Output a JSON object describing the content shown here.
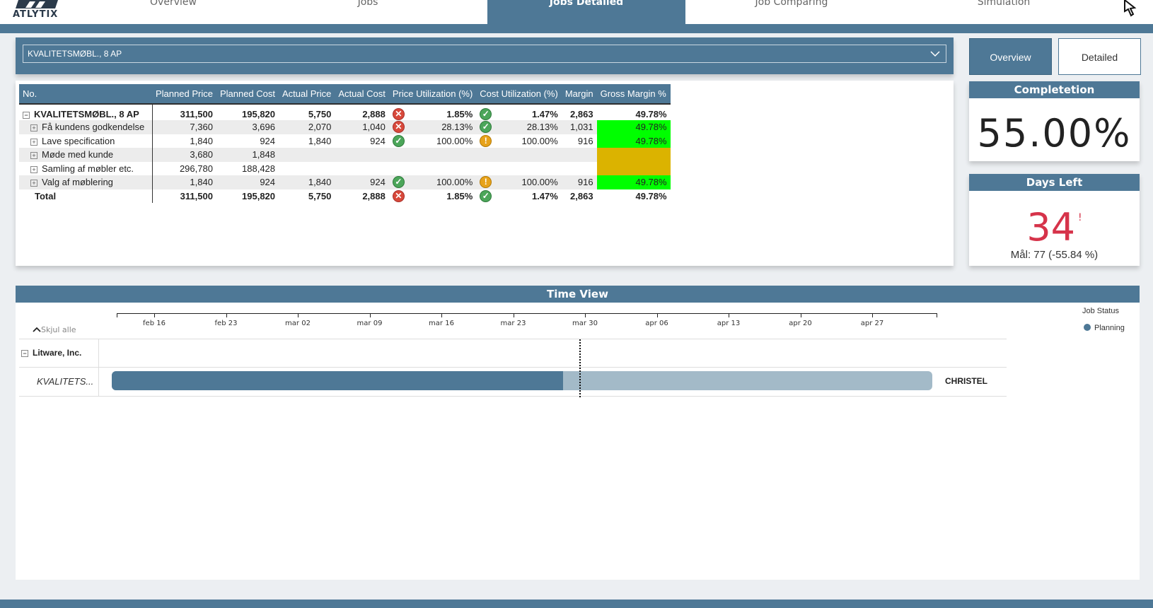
{
  "brand": {
    "name": "ATLYTIX"
  },
  "nav": {
    "tabs": [
      {
        "label": "Overview"
      },
      {
        "label": "Jobs"
      },
      {
        "label": "Jobs Detailed",
        "active": true
      },
      {
        "label": "Job Comparing"
      },
      {
        "label": "Simulation"
      }
    ]
  },
  "job_select": {
    "value": "KVALITETSMØBL., 8 AP"
  },
  "view_buttons": {
    "overview": "Overview",
    "detailed": "Detailed"
  },
  "matrix": {
    "headers": [
      "No.",
      "Planned Price",
      "Planned Cost",
      "Actual Price",
      "Actual Cost",
      "Price Utilization (%)",
      "Cost Utilization (%)",
      "Margin",
      "Gross Margin %"
    ],
    "rows": [
      {
        "name": "KVALITETSMØBL., 8 AP",
        "planned_price": "311,500",
        "planned_cost": "195,820",
        "actual_price": "5,750",
        "actual_cost": "2,888",
        "price_icon": "x",
        "price_util": "1.85%",
        "cost_icon": "ok",
        "cost_util": "1.47%",
        "margin": "2,863",
        "gross_margin": "49.78%"
      },
      {
        "name": "Få kundens godkendelse",
        "planned_price": "7,360",
        "planned_cost": "3,696",
        "actual_price": "2,070",
        "actual_cost": "1,040",
        "price_icon": "x",
        "price_util": "28.13%",
        "cost_icon": "ok",
        "cost_util": "28.13%",
        "margin": "1,031",
        "gross_margin": "49.78%"
      },
      {
        "name": "Lave specification",
        "planned_price": "1,840",
        "planned_cost": "924",
        "actual_price": "1,840",
        "actual_cost": "924",
        "price_icon": "ok",
        "price_util": "100.00%",
        "cost_icon": "warn",
        "cost_util": "100.00%",
        "margin": "916",
        "gross_margin": "49.78%"
      },
      {
        "name": "Møde med kunde",
        "planned_price": "3,680",
        "planned_cost": "1,848"
      },
      {
        "name": "Samling af møbler etc.",
        "planned_price": "296,780",
        "planned_cost": "188,428"
      },
      {
        "name": "Valg af møblering",
        "planned_price": "1,840",
        "planned_cost": "924",
        "actual_price": "1,840",
        "actual_cost": "924",
        "price_icon": "ok",
        "price_util": "100.00%",
        "cost_icon": "warn",
        "cost_util": "100.00%",
        "margin": "916",
        "gross_margin": "49.78%"
      }
    ],
    "total": {
      "name": "Total",
      "planned_price": "311,500",
      "planned_cost": "195,820",
      "actual_price": "5,750",
      "actual_cost": "2,888",
      "price_icon": "x",
      "price_util": "1.85%",
      "cost_icon": "ok",
      "cost_util": "1.47%",
      "margin": "2,863",
      "gross_margin": "49.78%"
    }
  },
  "completion": {
    "title": "Completetion",
    "value": "55.00%",
    "progress": 0.55
  },
  "days_left": {
    "title": "Days Left",
    "value": "34",
    "flag": "!",
    "target": "Mål: 77 (-55.84 %)"
  },
  "time_view": {
    "title": "Time View",
    "axis_ticks": [
      "feb 16",
      "feb 23",
      "mar 02",
      "mar 09",
      "mar 16",
      "mar 23",
      "mar 30",
      "apr 06",
      "apr 13",
      "apr 20",
      "apr 27"
    ],
    "collapse_all": "Skjul alle",
    "group": "Litware, Inc.",
    "job": "KVALITETS...",
    "resource": "CHRISTEL",
    "legend_title": "Job Status",
    "legend_item": "Planning",
    "status_color": "#4e7896"
  },
  "colors": {
    "accent": "#4e7896",
    "good": "#00ff00",
    "warning": "#dbb300",
    "bad": "#d6334a"
  }
}
